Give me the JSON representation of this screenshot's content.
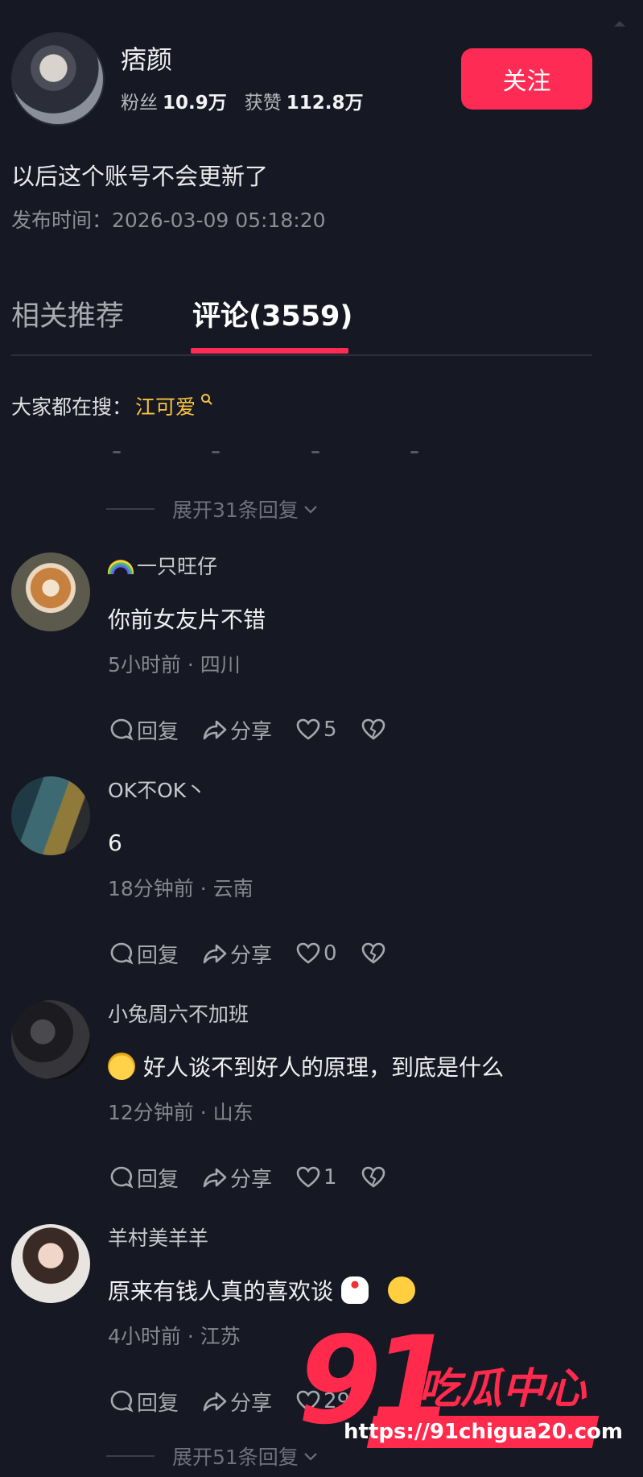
{
  "author": {
    "name": "痞颜",
    "followers_label": "粉丝",
    "followers_value": "10.9万",
    "likes_label": "获赞",
    "likes_value": "112.8万",
    "follow_label": "关注"
  },
  "post": {
    "title": "以后这个账号不会更新了",
    "publish_time": "发布时间：2026-03-09 05:18:20"
  },
  "tabs": {
    "related": "相关推荐",
    "comments": "评论(3559)"
  },
  "search": {
    "prefix": "大家都在搜：",
    "keyword": "江可爱"
  },
  "expand_top": "展开31条回复",
  "expand_bottom": "展开51条回复",
  "actions": {
    "reply": "回复",
    "share": "分享"
  },
  "comments": [
    {
      "name": "一只旺仔",
      "text": "你前女友片不错",
      "meta": "5小时前 · 四川",
      "likes": "5"
    },
    {
      "name": "OK不OK丶",
      "text": "6",
      "meta": "18分钟前 · 云南",
      "likes": "0"
    },
    {
      "name": "小兔周六不加班",
      "text": "好人谈不到好人的原理，到底是什么",
      "meta": "12分钟前 · 山东",
      "likes": "1"
    },
    {
      "name": "羊村美羊羊",
      "text": "原来有钱人真的喜欢谈",
      "meta": "4小时前 · 江苏",
      "likes": "29"
    }
  ],
  "watermark": {
    "number": "91",
    "text": "吃瓜中心",
    "url": "https://91chigua20.com"
  },
  "colors": {
    "background": "#161823",
    "accent": "#fe2c55",
    "keyword": "#f7c33f"
  }
}
